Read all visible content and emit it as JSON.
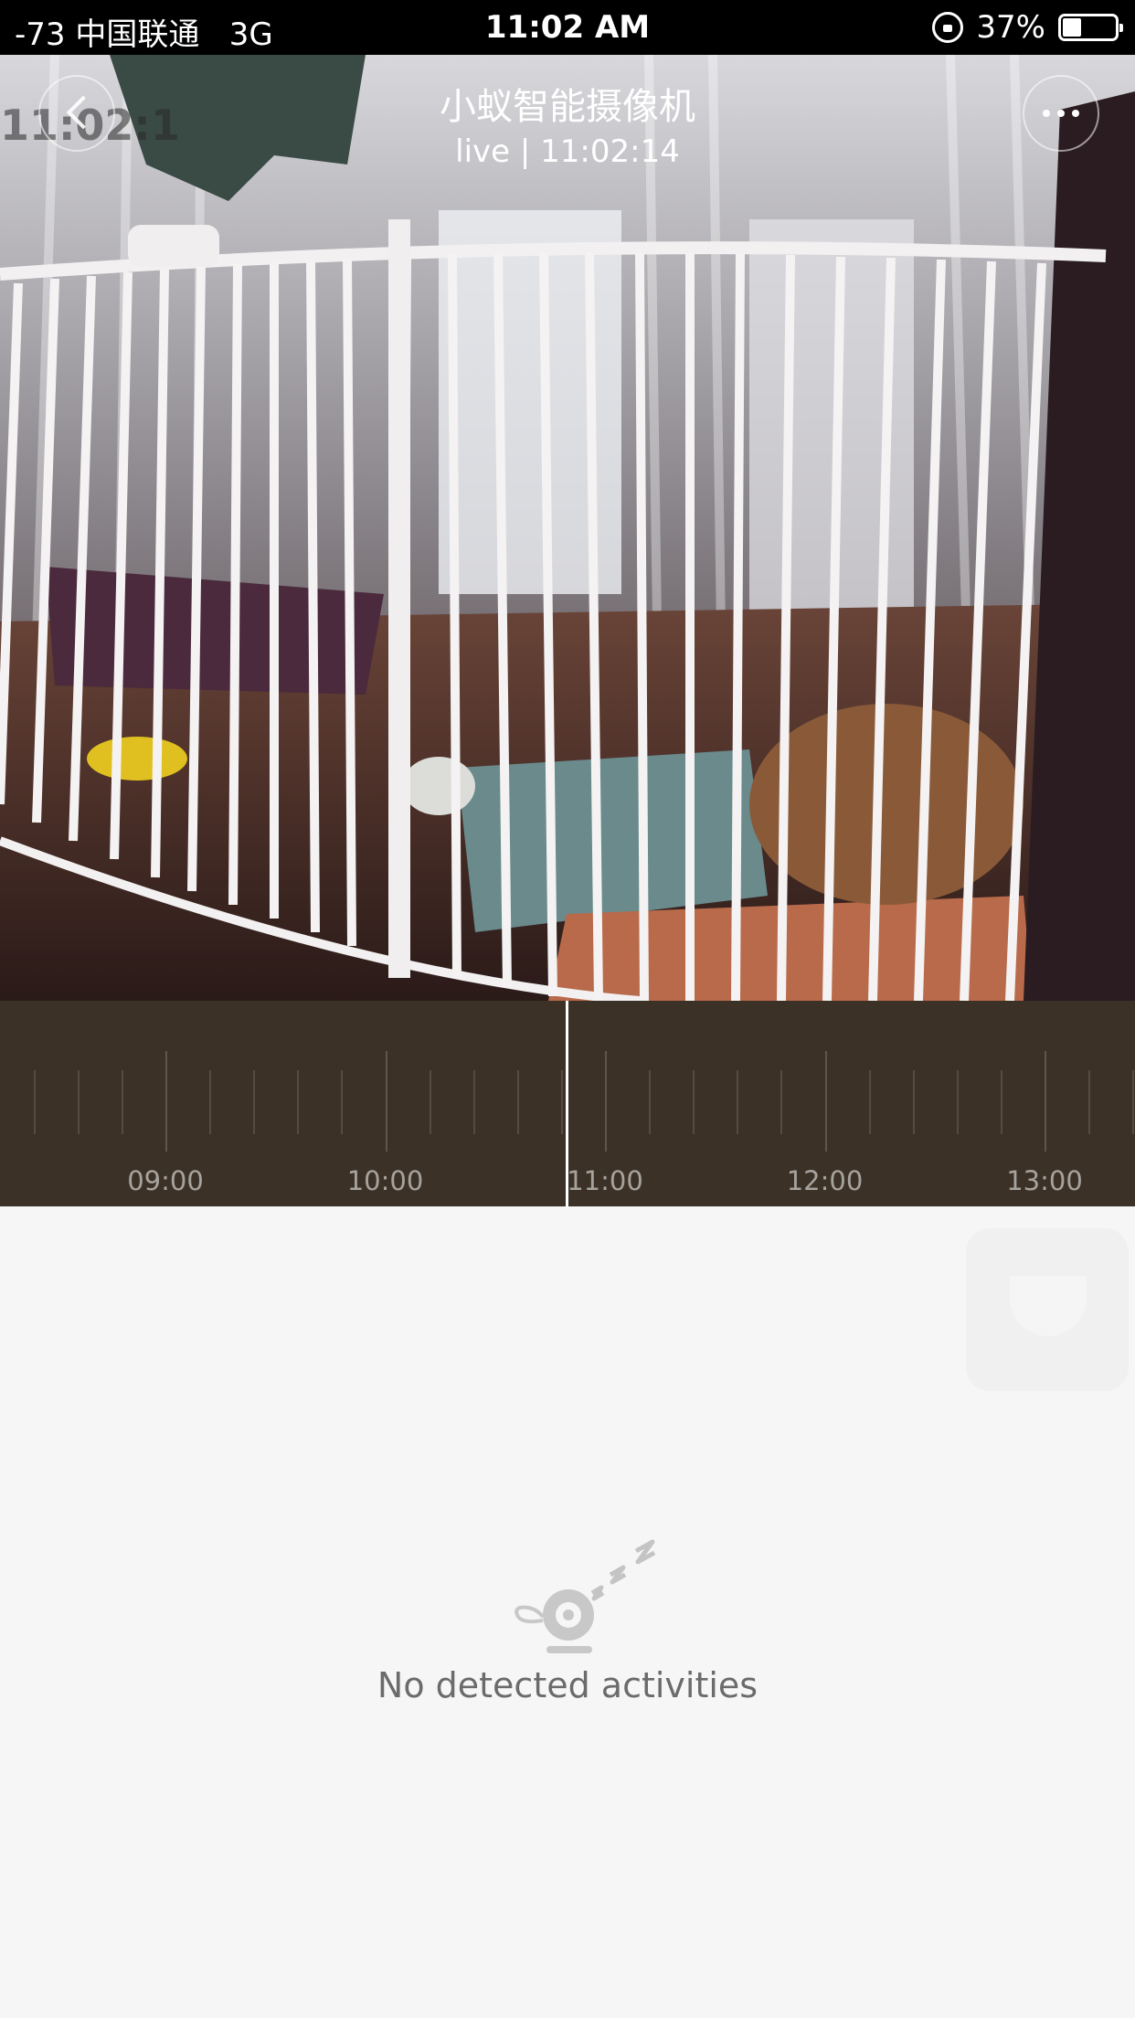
{
  "status_bar": {
    "left": "-73 中国联通   3G",
    "time": "11:02 AM",
    "battery": "37%"
  },
  "video": {
    "osd_time": "11:02:1",
    "title": "小蚁智能摄像机",
    "live_status": "live | 11:02:14"
  },
  "timeline": {
    "labels": [
      "09:00",
      "10:00",
      "11:00",
      "12:00",
      "13:00"
    ]
  },
  "empty_state": {
    "message": "No detected activities"
  },
  "icons": {
    "back": "chevron-left-icon",
    "more": "more-dots-icon",
    "lock": "orientation-lock-icon",
    "battery": "battery-icon",
    "empty": "sleeping-camera-icon"
  }
}
